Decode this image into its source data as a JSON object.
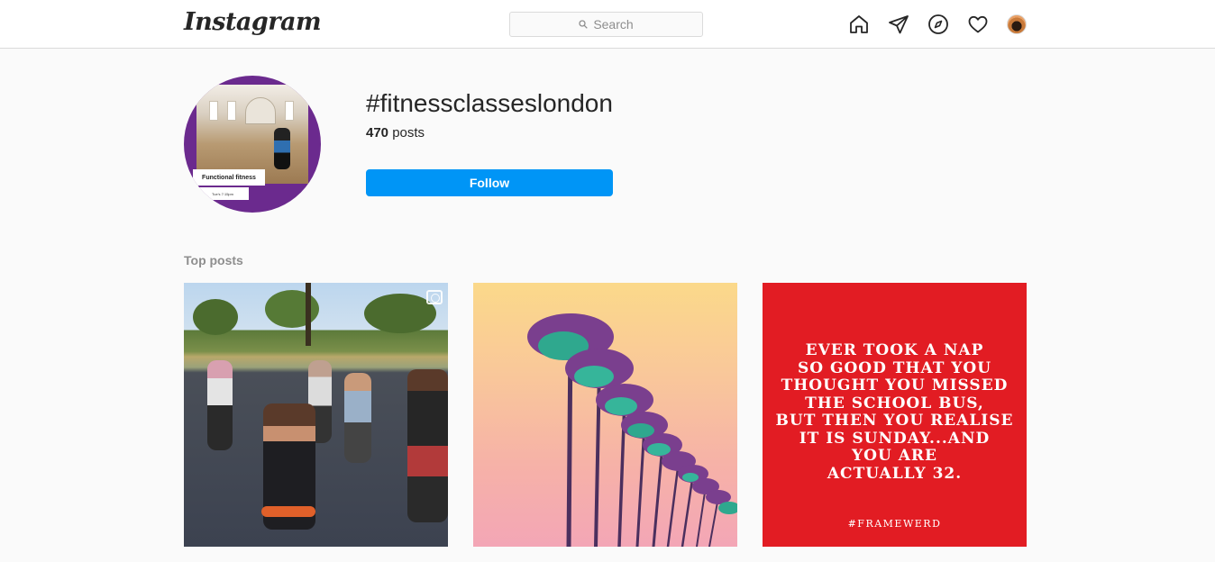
{
  "header": {
    "logo": "Instagram",
    "search_placeholder": "Search",
    "nav_icons": [
      "home-icon",
      "direct-icon",
      "explore-icon",
      "activity-icon",
      "profile-avatar"
    ]
  },
  "hashtag": {
    "title": "#fitnessclasseslondon",
    "post_count": "470",
    "post_count_label": " posts",
    "follow_label": "Follow",
    "avatar_banner": "Functional fitness",
    "avatar_subtext": "Tue's 7:15pm"
  },
  "top_posts": {
    "label": "Top posts",
    "posts": [
      {
        "kind": "photo",
        "description_icon": "carousel-icon"
      },
      {
        "kind": "photo"
      },
      {
        "kind": "quote",
        "text": "EVER TOOK A NAP\nSO GOOD THAT YOU\nTHOUGHT YOU MISSED\nTHE SCHOOL BUS,\nBUT THEN YOU REALISE\nIT IS SUNDAY...AND\nYOU ARE\nACTUALLY 32.",
        "credit": "#FRAMEWERD"
      }
    ]
  },
  "colors": {
    "accent": "#0095f6",
    "quote_bg": "#e21c23",
    "avatar_ring": "#6b2a8e"
  }
}
